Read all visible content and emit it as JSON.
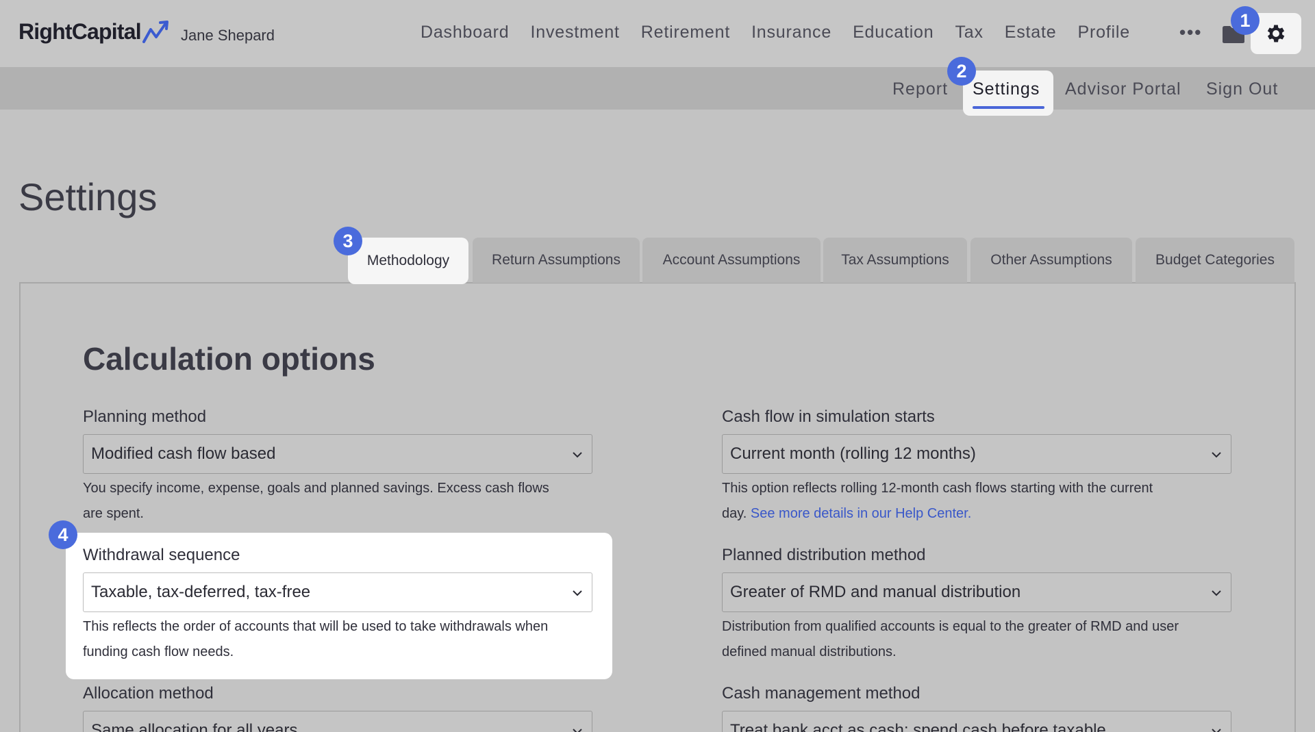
{
  "brand": {
    "name": "RightCapital"
  },
  "client": {
    "name": "Jane Shepard"
  },
  "main_nav": [
    "Dashboard",
    "Investment",
    "Retirement",
    "Insurance",
    "Education",
    "Tax",
    "Estate",
    "Profile"
  ],
  "more_label": "•••",
  "sub_nav": {
    "report": "Report",
    "settings": "Settings",
    "advisor_portal": "Advisor Portal",
    "sign_out": "Sign Out"
  },
  "page": {
    "title": "Settings"
  },
  "tabs": [
    "Methodology",
    "Return Assumptions",
    "Account Assumptions",
    "Tax Assumptions",
    "Other Assumptions",
    "Budget Categories"
  ],
  "section": {
    "title": "Calculation options"
  },
  "fields": {
    "planning_method": {
      "label": "Planning method",
      "value": "Modified cash flow based",
      "help_line1": "You specify income, expense, goals and planned savings. Excess cash flows",
      "help_line2": "are spent."
    },
    "cash_flow_start": {
      "label": "Cash flow in simulation starts",
      "value": "Current month (rolling 12 months)",
      "help_line1": "This option reflects rolling 12-month cash flows starting with the current",
      "help_line2": "day.",
      "help_link": "See more details in our Help Center."
    },
    "withdrawal_sequence": {
      "label": "Withdrawal sequence",
      "value": "Taxable, tax-deferred, tax-free",
      "help_line1": "This reflects the order of accounts that will be used to take withdrawals when",
      "help_line2": "funding cash flow needs."
    },
    "planned_distribution": {
      "label": "Planned distribution method",
      "value": "Greater of RMD and manual distribution",
      "help_line1": "Distribution from qualified accounts is equal to the greater of RMD and user",
      "help_line2": "defined manual distributions."
    },
    "allocation_method": {
      "label": "Allocation method",
      "value": "Same allocation for all years"
    },
    "cash_management": {
      "label": "Cash management method",
      "value": "Treat bank acct as cash; spend cash before taxable"
    }
  },
  "badges": [
    "1",
    "2",
    "3",
    "4"
  ],
  "colors": {
    "accent": "#4a6bdc",
    "link": "#3957c9",
    "underline": "#4a66d8"
  },
  "icons": {
    "logo": "trend-arrow-icon",
    "folder": "folder-icon",
    "gear": "gear-icon",
    "chevron": "chevron-down-icon"
  }
}
